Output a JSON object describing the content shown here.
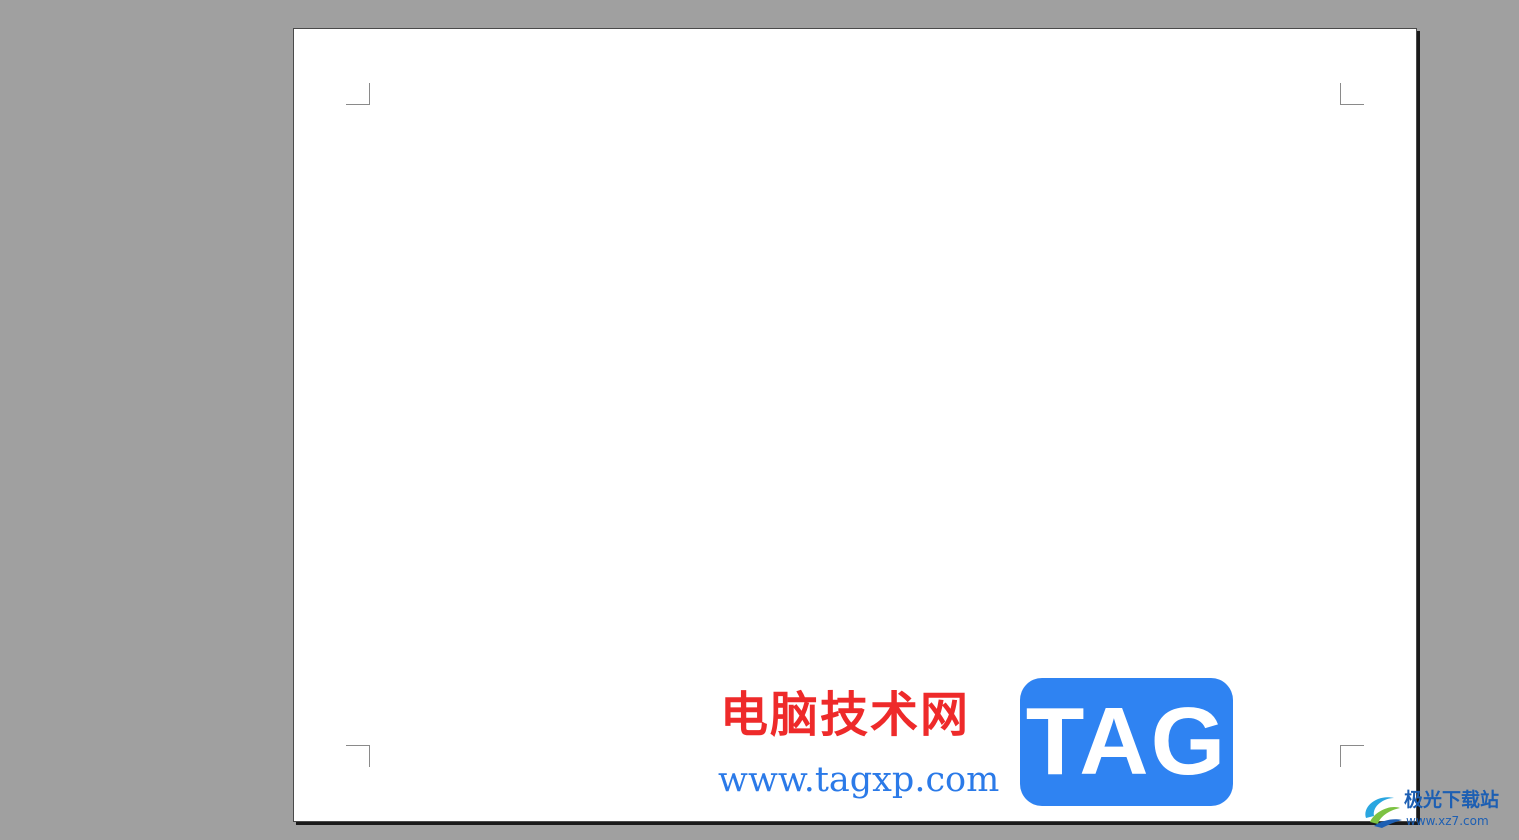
{
  "document": {
    "page_background": "#ffffff",
    "workspace_background": "#a0a0a0"
  },
  "watermark": {
    "chinese_text": "电脑技术网",
    "url_text": "www.tagxp.com",
    "tag_text": "TAG",
    "colors": {
      "chinese": "#ee2a2a",
      "url": "#2b7ae8",
      "tag_bg": "#2f83f2"
    }
  },
  "corner_brand": {
    "name": "极光下载站",
    "domain": "www.xz7.com",
    "logo_icon": "aurora-swirl-icon"
  }
}
